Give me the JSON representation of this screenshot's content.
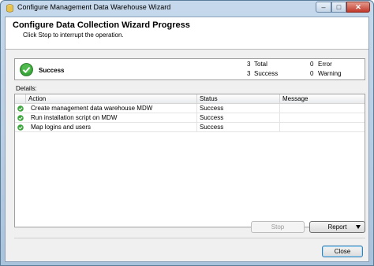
{
  "window": {
    "title": "Configure Management Data Warehouse Wizard",
    "minimize_glyph": "–",
    "maximize_glyph": "□",
    "close_glyph": "✕"
  },
  "header": {
    "title": "Configure Data Collection Wizard Progress",
    "subtitle": "Click Stop to interrupt the operation."
  },
  "summary": {
    "status": "Success",
    "total_count": "3",
    "total_label": "Total",
    "success_count": "3",
    "success_label": "Success",
    "error_count": "0",
    "error_label": "Error",
    "warning_count": "0",
    "warning_label": "Warning"
  },
  "details": {
    "label": "Details:",
    "columns": [
      "Action",
      "Status",
      "Message"
    ],
    "rows": [
      {
        "action": "Create management data warehouse MDW",
        "status": "Success",
        "message": ""
      },
      {
        "action": "Run installation script on MDW",
        "status": "Success",
        "message": ""
      },
      {
        "action": "Map logins and users",
        "status": "Success",
        "message": ""
      }
    ]
  },
  "buttons": {
    "stop": "Stop",
    "report": "Report",
    "close": "Close"
  },
  "colors": {
    "success_green": "#3aa53a",
    "title_bar": "#b9cfe5",
    "accent_blue": "#3c7fb1"
  },
  "icons": {
    "app": "database-icon",
    "status": "check-circle-icon"
  }
}
